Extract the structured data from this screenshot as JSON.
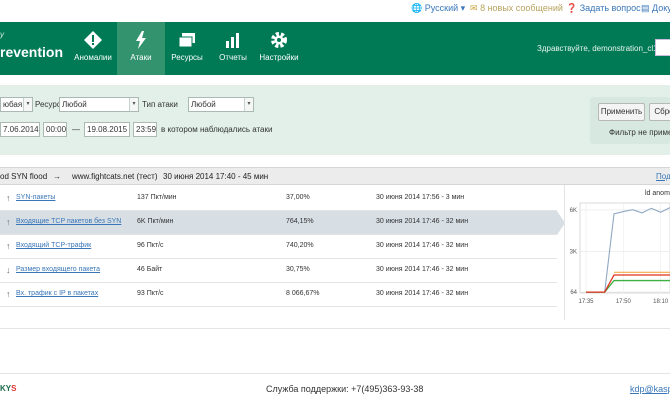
{
  "topbar": {
    "language": "Русский",
    "messages": "8 новых сообщений",
    "ask": "Задать вопрос",
    "docs": "Доку"
  },
  "header": {
    "logo_small": "y",
    "logo": "revention",
    "greeting": "Здравствуйте, demonstration_cl101",
    "nav": [
      {
        "label": "Аномалии",
        "icon": "warning-diamond-icon"
      },
      {
        "label": "Атаки",
        "icon": "lightning-icon",
        "active": true
      },
      {
        "label": "Ресурсы",
        "icon": "folders-icon"
      },
      {
        "label": "Отчеты",
        "icon": "bar-chart-icon"
      },
      {
        "label": "Настройки",
        "icon": "gear-icon"
      }
    ]
  },
  "filter": {
    "type_value": "юбая",
    "resource_label": "Ресурс",
    "resource_value": "Любой",
    "attack_type_label": "Тип атаки",
    "attack_type_value": "Любой",
    "date_from": "7.06.2014",
    "time_from": "00:00",
    "dash": "—",
    "date_to": "19.08.2015",
    "time_to": "23:59",
    "period_label": "в котором наблюдались атаки",
    "apply": "Применить",
    "reset": "Сбро",
    "note": "Фильтр не приме"
  },
  "attack": {
    "name": "od SYN flood",
    "arrow": "→",
    "resource": "www.fightcats.net (тест)",
    "period": "30 июня 2014 17:40 -  45 мин",
    "link": "Под"
  },
  "table": {
    "rows": [
      {
        "dir": "↑",
        "metric": "SYN-пакеты",
        "value": "137 Пкт/мин",
        "percent": "37,00%",
        "time": "30 июня 2014 17:56 - 3 мин"
      },
      {
        "dir": "↑",
        "metric": "Входящие TCP пакетов без SYN",
        "value": "6K Пкт/мин",
        "percent": "764,15%",
        "time": "30 июня 2014 17:46 - 32 мин",
        "selected": true
      },
      {
        "dir": "↑",
        "metric": "Входящий TCP-трафик",
        "value": "96 Пкт/с",
        "percent": "740,20%",
        "time": "30 июня 2014 17:46 - 32 мин"
      },
      {
        "dir": "↓",
        "metric": "Размер входящего пакета",
        "value": "46 Байт",
        "percent": "30,75%",
        "time": "30 июня 2014 17:46 - 32 мин"
      },
      {
        "dir": "↑",
        "metric": "Вх. трафик с IP в пакетах",
        "value": "93 Пкт/с",
        "percent": "8 066,67%",
        "time": "30 июня 2014 17:46 - 32 мин"
      }
    ]
  },
  "chart": {
    "title": "ld anom",
    "y_ticks": [
      "6K",
      "3K",
      "64"
    ],
    "x_ticks": [
      "17:35",
      "17:50",
      "18:10"
    ],
    "colors": {
      "main": "#8fa9c4",
      "green": "#3cb043",
      "red": "#e0301e",
      "orange": "#f0a030"
    }
  },
  "chart_data": {
    "type": "line",
    "title": "ld anom",
    "xlabel": "",
    "ylabel": "",
    "x": [
      "17:35",
      "17:40",
      "17:45",
      "17:48",
      "17:50",
      "17:55",
      "18:00",
      "18:05",
      "18:10",
      "18:15"
    ],
    "series": [
      {
        "values": [
          64,
          64,
          64,
          5500,
          6100,
          5800,
          6000,
          5900,
          6050,
          5950
        ]
      },
      {
        "values": [
          64,
          64,
          64,
          900,
          900,
          900,
          900,
          900,
          900,
          900
        ]
      },
      {
        "values": [
          64,
          64,
          64,
          1300,
          1300,
          1300,
          1300,
          1300,
          1300,
          1300
        ]
      }
    ],
    "ylim": [
      0,
      6500
    ]
  },
  "footer": {
    "logo": "KY",
    "logo_mark": "S",
    "support": "Служба поддержки: +7(495)363-93-38",
    "mail": "kdp@kasp"
  }
}
